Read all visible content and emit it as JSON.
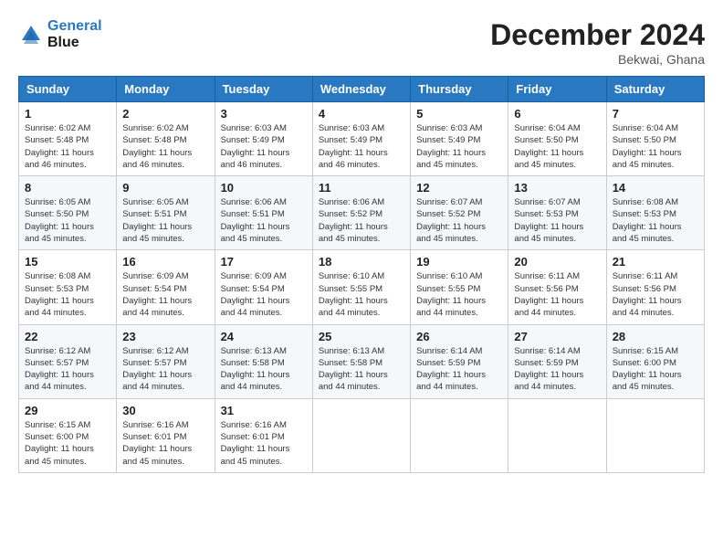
{
  "header": {
    "logo_line1": "General",
    "logo_line2": "Blue",
    "month_title": "December 2024",
    "location": "Bekwai, Ghana"
  },
  "weekdays": [
    "Sunday",
    "Monday",
    "Tuesday",
    "Wednesday",
    "Thursday",
    "Friday",
    "Saturday"
  ],
  "weeks": [
    [
      {
        "day": "1",
        "sunrise": "6:02 AM",
        "sunset": "5:48 PM",
        "daylight": "11 hours and 46 minutes."
      },
      {
        "day": "2",
        "sunrise": "6:02 AM",
        "sunset": "5:48 PM",
        "daylight": "11 hours and 46 minutes."
      },
      {
        "day": "3",
        "sunrise": "6:03 AM",
        "sunset": "5:49 PM",
        "daylight": "11 hours and 46 minutes."
      },
      {
        "day": "4",
        "sunrise": "6:03 AM",
        "sunset": "5:49 PM",
        "daylight": "11 hours and 46 minutes."
      },
      {
        "day": "5",
        "sunrise": "6:03 AM",
        "sunset": "5:49 PM",
        "daylight": "11 hours and 45 minutes."
      },
      {
        "day": "6",
        "sunrise": "6:04 AM",
        "sunset": "5:50 PM",
        "daylight": "11 hours and 45 minutes."
      },
      {
        "day": "7",
        "sunrise": "6:04 AM",
        "sunset": "5:50 PM",
        "daylight": "11 hours and 45 minutes."
      }
    ],
    [
      {
        "day": "8",
        "sunrise": "6:05 AM",
        "sunset": "5:50 PM",
        "daylight": "11 hours and 45 minutes."
      },
      {
        "day": "9",
        "sunrise": "6:05 AM",
        "sunset": "5:51 PM",
        "daylight": "11 hours and 45 minutes."
      },
      {
        "day": "10",
        "sunrise": "6:06 AM",
        "sunset": "5:51 PM",
        "daylight": "11 hours and 45 minutes."
      },
      {
        "day": "11",
        "sunrise": "6:06 AM",
        "sunset": "5:52 PM",
        "daylight": "11 hours and 45 minutes."
      },
      {
        "day": "12",
        "sunrise": "6:07 AM",
        "sunset": "5:52 PM",
        "daylight": "11 hours and 45 minutes."
      },
      {
        "day": "13",
        "sunrise": "6:07 AM",
        "sunset": "5:53 PM",
        "daylight": "11 hours and 45 minutes."
      },
      {
        "day": "14",
        "sunrise": "6:08 AM",
        "sunset": "5:53 PM",
        "daylight": "11 hours and 45 minutes."
      }
    ],
    [
      {
        "day": "15",
        "sunrise": "6:08 AM",
        "sunset": "5:53 PM",
        "daylight": "11 hours and 44 minutes."
      },
      {
        "day": "16",
        "sunrise": "6:09 AM",
        "sunset": "5:54 PM",
        "daylight": "11 hours and 44 minutes."
      },
      {
        "day": "17",
        "sunrise": "6:09 AM",
        "sunset": "5:54 PM",
        "daylight": "11 hours and 44 minutes."
      },
      {
        "day": "18",
        "sunrise": "6:10 AM",
        "sunset": "5:55 PM",
        "daylight": "11 hours and 44 minutes."
      },
      {
        "day": "19",
        "sunrise": "6:10 AM",
        "sunset": "5:55 PM",
        "daylight": "11 hours and 44 minutes."
      },
      {
        "day": "20",
        "sunrise": "6:11 AM",
        "sunset": "5:56 PM",
        "daylight": "11 hours and 44 minutes."
      },
      {
        "day": "21",
        "sunrise": "6:11 AM",
        "sunset": "5:56 PM",
        "daylight": "11 hours and 44 minutes."
      }
    ],
    [
      {
        "day": "22",
        "sunrise": "6:12 AM",
        "sunset": "5:57 PM",
        "daylight": "11 hours and 44 minutes."
      },
      {
        "day": "23",
        "sunrise": "6:12 AM",
        "sunset": "5:57 PM",
        "daylight": "11 hours and 44 minutes."
      },
      {
        "day": "24",
        "sunrise": "6:13 AM",
        "sunset": "5:58 PM",
        "daylight": "11 hours and 44 minutes."
      },
      {
        "day": "25",
        "sunrise": "6:13 AM",
        "sunset": "5:58 PM",
        "daylight": "11 hours and 44 minutes."
      },
      {
        "day": "26",
        "sunrise": "6:14 AM",
        "sunset": "5:59 PM",
        "daylight": "11 hours and 44 minutes."
      },
      {
        "day": "27",
        "sunrise": "6:14 AM",
        "sunset": "5:59 PM",
        "daylight": "11 hours and 44 minutes."
      },
      {
        "day": "28",
        "sunrise": "6:15 AM",
        "sunset": "6:00 PM",
        "daylight": "11 hours and 45 minutes."
      }
    ],
    [
      {
        "day": "29",
        "sunrise": "6:15 AM",
        "sunset": "6:00 PM",
        "daylight": "11 hours and 45 minutes."
      },
      {
        "day": "30",
        "sunrise": "6:16 AM",
        "sunset": "6:01 PM",
        "daylight": "11 hours and 45 minutes."
      },
      {
        "day": "31",
        "sunrise": "6:16 AM",
        "sunset": "6:01 PM",
        "daylight": "11 hours and 45 minutes."
      },
      null,
      null,
      null,
      null
    ]
  ],
  "labels": {
    "sunrise_prefix": "Sunrise: ",
    "sunset_prefix": "Sunset: ",
    "daylight_prefix": "Daylight: "
  }
}
